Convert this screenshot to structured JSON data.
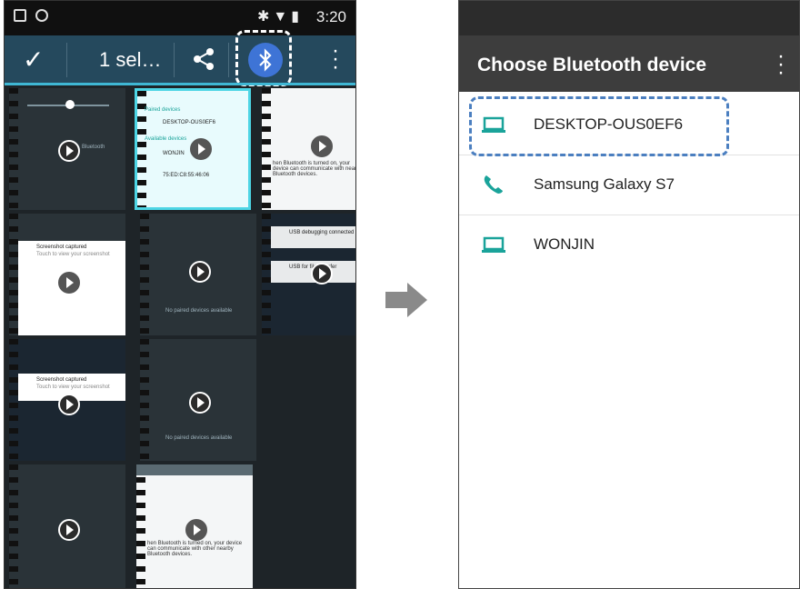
{
  "left_screen": {
    "status_time": "3:20",
    "app_bar": {
      "selection_label": "1 sel…",
      "confirm_icon": "check-icon",
      "share_icon": "share-icon",
      "bluetooth_icon": "bluetooth-icon",
      "overflow_icon": "more-vert-icon"
    },
    "thumbnails": {
      "t1": {
        "labels": [
          "Bluetooth"
        ]
      },
      "t2": {
        "labels": [
          "Paired devices",
          "DESKTOP-OUS0EF6",
          "Available devices",
          "WONJIN",
          "75:ED:C8:55:46:06"
        ]
      },
      "t3": {
        "text": "hen Bluetooth is turned on, your device can communicate with nearby Bluetooth devices."
      },
      "t4": {
        "labels": [
          "Screenshot captured",
          "Touch to view your screenshot"
        ]
      },
      "t5": {
        "labels": [
          "No paired devices available"
        ]
      },
      "t6": {
        "labels": [
          "USB debugging connected",
          "USB for file transfer"
        ]
      },
      "t7": {
        "labels": [
          "Screenshot captured",
          "Touch to view your screenshot"
        ]
      },
      "t8": {
        "labels": [
          "No paired devices available"
        ]
      },
      "t10": {
        "text": "hen Bluetooth is turned on, your device can communicate with other nearby Bluetooth devices."
      }
    }
  },
  "right_screen": {
    "title": "Choose Bluetooth device",
    "overflow_icon": "more-vert-icon",
    "devices": [
      {
        "name": "DESKTOP-OUS0EF6",
        "icon": "laptop-icon"
      },
      {
        "name": "Samsung Galaxy S7",
        "icon": "phone-icon"
      },
      {
        "name": "WONJIN",
        "icon": "laptop-icon"
      }
    ]
  },
  "colors": {
    "accent_teal": "#1aa39a",
    "bluetooth_blue": "#3e74d6",
    "highlight_dash": "#4b7fc0"
  }
}
